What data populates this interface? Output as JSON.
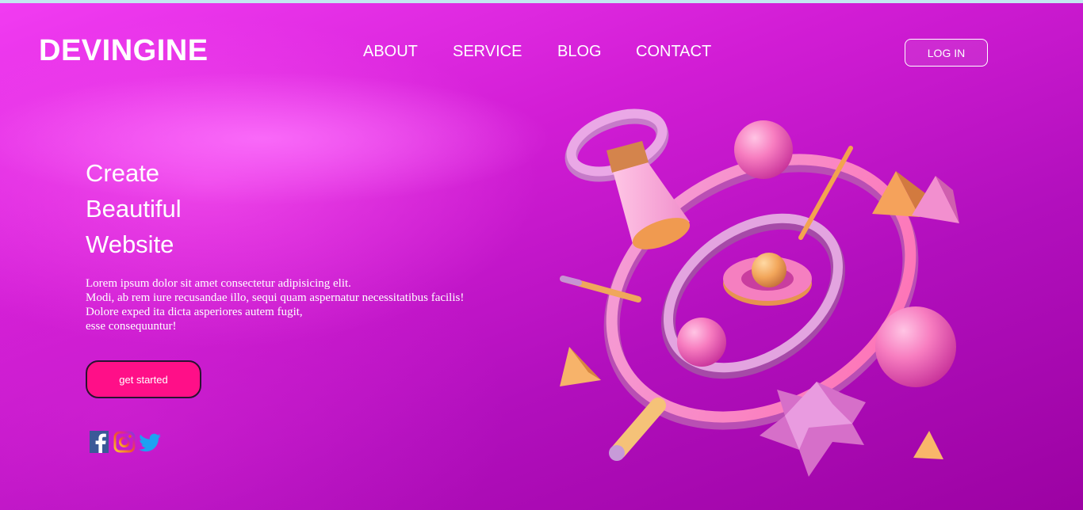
{
  "brand": {
    "name": "DEVINGINE"
  },
  "nav": {
    "items": [
      {
        "label": "ABOUT"
      },
      {
        "label": "SERVICE"
      },
      {
        "label": "BLOG"
      },
      {
        "label": "CONTACT"
      }
    ],
    "login_label": "LOG IN"
  },
  "hero": {
    "headline_lines": [
      "Create",
      "Beautiful",
      "Website"
    ],
    "body": "Lorem ipsum dolor sit amet consectetur adipisicing elit.\nModi, ab rem iure recusandae illo, sequi quam aspernatur necessitatibus facilis!\nDolore exped ita dicta asperiores autem fugit,\nesse consequuntur!",
    "cta_label": "get started"
  },
  "social": {
    "icons": [
      "facebook-icon",
      "instagram-icon",
      "twitter-icon"
    ]
  },
  "colors": {
    "background": "#b20fbd",
    "cta": "#ff0f88",
    "topbar": "#c3e7f0"
  }
}
